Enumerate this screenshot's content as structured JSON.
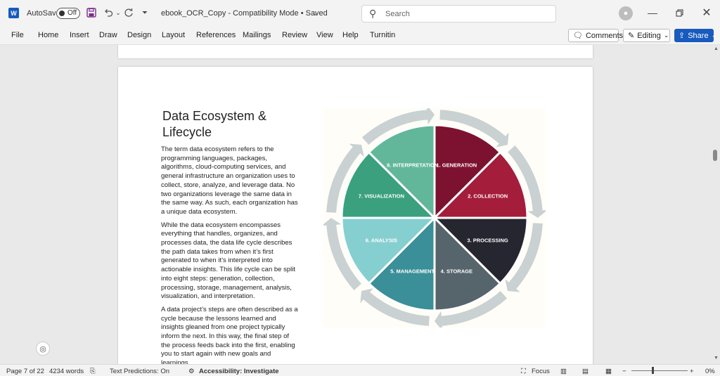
{
  "titlebar": {
    "app_icon": "W",
    "autosave_label": "AutoSave",
    "autosave_state": "Off",
    "document_title": "ebook_OCR_Copy  -  Compatibility Mode  •  Saved",
    "search_placeholder": "Search",
    "icons": [
      "save-icon",
      "undo-icon",
      "redo-icon",
      "customize-icon",
      "search-icon",
      "account-icon",
      "minimize-icon",
      "restore-icon",
      "close-icon"
    ]
  },
  "ribbon": {
    "tabs": [
      "File",
      "Home",
      "Insert",
      "Draw",
      "Design",
      "Layout",
      "References",
      "Mailings",
      "Review",
      "View",
      "Help",
      "Turnitin"
    ],
    "comments_label": "Comments",
    "editing_label": "Editing",
    "share_label": "Share"
  },
  "document": {
    "heading": "Data Ecosystem & Lifecycle",
    "paragraphs": [
      "The term data ecosystem refers to the programming languages, packages, algorithms, cloud-computing services, and general infrastructure an organization uses to collect, store, analyze, and leverage data. No two organizations leverage the same data in the same way. As such, each organization has a unique data ecosystem.",
      "While the data ecosystem encompasses everything that handles, organizes, and processes data, the data life cycle describes the path data takes from when it’s first generated to when it’s interpreted into actionable insights. This life cycle can be split into eight steps: generation, collection, processing, storage, management, analysis, visualization, and interpretation.",
      "A data project’s steps are often described as a cycle because the lessons learned and insights gleaned from one project typically inform the next. In this way, the final step of the process feeds back into the first, enabling you to start again with new goals and learnings."
    ],
    "diagram": {
      "segments": [
        {
          "label": "1. GENERATION",
          "color": "#7d1230"
        },
        {
          "label": "2. COLLECTION",
          "color": "#a41d3a"
        },
        {
          "label": "3. PROCESSING",
          "color": "#262630"
        },
        {
          "label": "4. STORAGE",
          "color": "#56656b"
        },
        {
          "label": "5. MANAGEMENT",
          "color": "#3a8f98"
        },
        {
          "label": "6. ANALYSIS",
          "color": "#86cfd1"
        },
        {
          "label": "7. VISUALIZATION",
          "color": "#3aa07d"
        },
        {
          "label": "8. INTERPRETATION",
          "color": "#62b79a"
        }
      ],
      "arrow_color": "#c9d1d2"
    }
  },
  "statusbar": {
    "page": "Page 7 of 22",
    "words": "4234 words",
    "text_predictions": "Text Predictions: On",
    "accessibility": "Accessibility: Investigate",
    "focus": "Focus",
    "zoom": "0%"
  }
}
